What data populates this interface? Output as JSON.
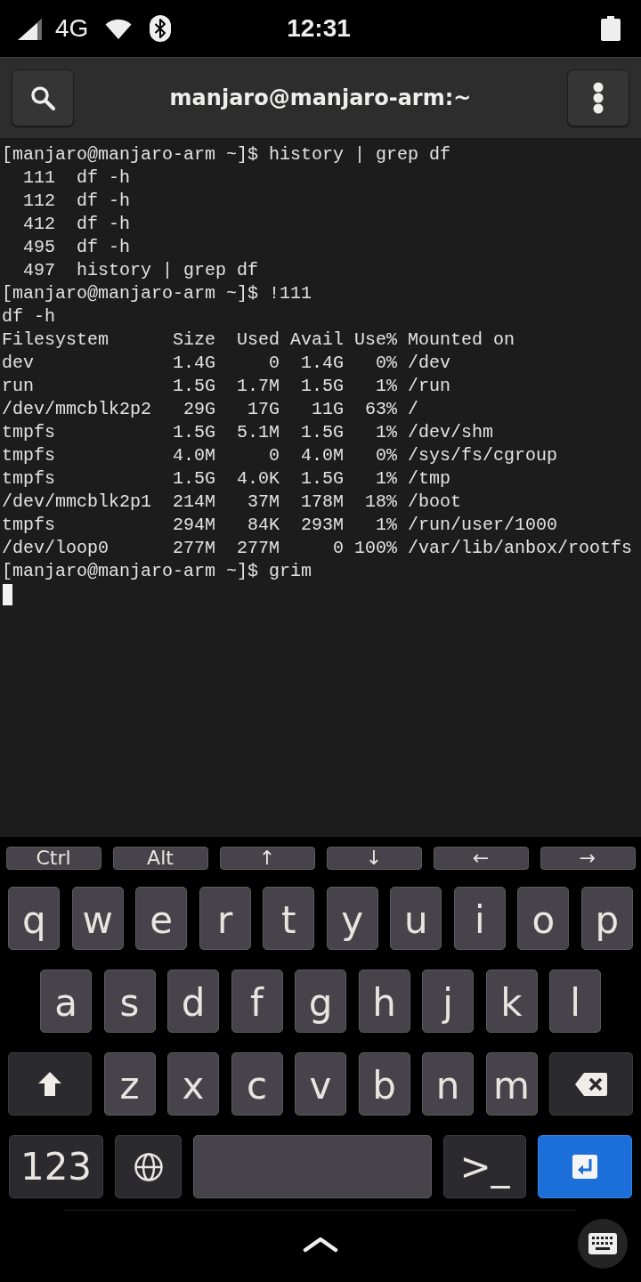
{
  "status_bar": {
    "network": "4G",
    "time": "12:31"
  },
  "header": {
    "title": "manjaro@manjaro-arm:~"
  },
  "terminal": {
    "items": [
      {
        "kind": "prompt",
        "prompt": "[manjaro@manjaro-arm ~]$",
        "command": "history | grep df"
      },
      {
        "kind": "history",
        "number": "111",
        "command": "df -h"
      },
      {
        "kind": "history",
        "number": "112",
        "command": "df -h"
      },
      {
        "kind": "history",
        "number": "412",
        "command": "df -h"
      },
      {
        "kind": "history",
        "number": "495",
        "command": "df -h"
      },
      {
        "kind": "history",
        "number": "497",
        "command": "history | grep df"
      },
      {
        "kind": "prompt",
        "prompt": "[manjaro@manjaro-arm ~]$",
        "command": "!111"
      },
      {
        "kind": "output",
        "text": "df -h"
      },
      {
        "kind": "table",
        "columns": [
          "Filesystem",
          "Size",
          "Used",
          "Avail",
          "Use%",
          "Mounted on"
        ],
        "rows": [
          [
            "dev",
            "1.4G",
            "0",
            "1.4G",
            "0%",
            "/dev"
          ],
          [
            "run",
            "1.5G",
            "1.7M",
            "1.5G",
            "1%",
            "/run"
          ],
          [
            "/dev/mmcblk2p2",
            "29G",
            "17G",
            "11G",
            "63%",
            "/"
          ],
          [
            "tmpfs",
            "1.5G",
            "5.1M",
            "1.5G",
            "1%",
            "/dev/shm"
          ],
          [
            "tmpfs",
            "4.0M",
            "0",
            "4.0M",
            "0%",
            "/sys/fs/cgroup"
          ],
          [
            "tmpfs",
            "1.5G",
            "4.0K",
            "1.5G",
            "1%",
            "/tmp"
          ],
          [
            "/dev/mmcblk2p1",
            "214M",
            "37M",
            "178M",
            "18%",
            "/boot"
          ],
          [
            "tmpfs",
            "294M",
            "84K",
            "293M",
            "1%",
            "/run/user/1000"
          ],
          [
            "/dev/loop0",
            "277M",
            "277M",
            "0",
            "100%",
            "/var/lib/anbox/rootfs"
          ]
        ]
      },
      {
        "kind": "prompt",
        "prompt": "[manjaro@manjaro-arm ~]$",
        "command": "grim"
      },
      {
        "kind": "cursor"
      }
    ]
  },
  "keyboard": {
    "extra_keys": [
      "Ctrl",
      "Alt",
      "↑",
      "↓",
      "←",
      "→"
    ],
    "rows": [
      [
        {
          "kind": "char",
          "label": "q"
        },
        {
          "kind": "char",
          "label": "w"
        },
        {
          "kind": "char",
          "label": "e"
        },
        {
          "kind": "char",
          "label": "r"
        },
        {
          "kind": "char",
          "label": "t"
        },
        {
          "kind": "char",
          "label": "y"
        },
        {
          "kind": "char",
          "label": "u"
        },
        {
          "kind": "char",
          "label": "i"
        },
        {
          "kind": "char",
          "label": "o"
        },
        {
          "kind": "char",
          "label": "p"
        }
      ],
      [
        {
          "kind": "char",
          "label": "a"
        },
        {
          "kind": "char",
          "label": "s"
        },
        {
          "kind": "char",
          "label": "d"
        },
        {
          "kind": "char",
          "label": "f"
        },
        {
          "kind": "char",
          "label": "g"
        },
        {
          "kind": "char",
          "label": "h"
        },
        {
          "kind": "char",
          "label": "j"
        },
        {
          "kind": "char",
          "label": "k"
        },
        {
          "kind": "char",
          "label": "l"
        }
      ],
      [
        {
          "kind": "shift"
        },
        {
          "kind": "char",
          "label": "z"
        },
        {
          "kind": "char",
          "label": "x"
        },
        {
          "kind": "char",
          "label": "c"
        },
        {
          "kind": "char",
          "label": "v"
        },
        {
          "kind": "char",
          "label": "b"
        },
        {
          "kind": "char",
          "label": "n"
        },
        {
          "kind": "char",
          "label": "m"
        },
        {
          "kind": "backspace"
        }
      ],
      [
        {
          "kind": "text",
          "label": "123"
        },
        {
          "kind": "globe"
        },
        {
          "kind": "space"
        },
        {
          "kind": "text",
          "label": ">_"
        },
        {
          "kind": "enter"
        }
      ]
    ]
  }
}
